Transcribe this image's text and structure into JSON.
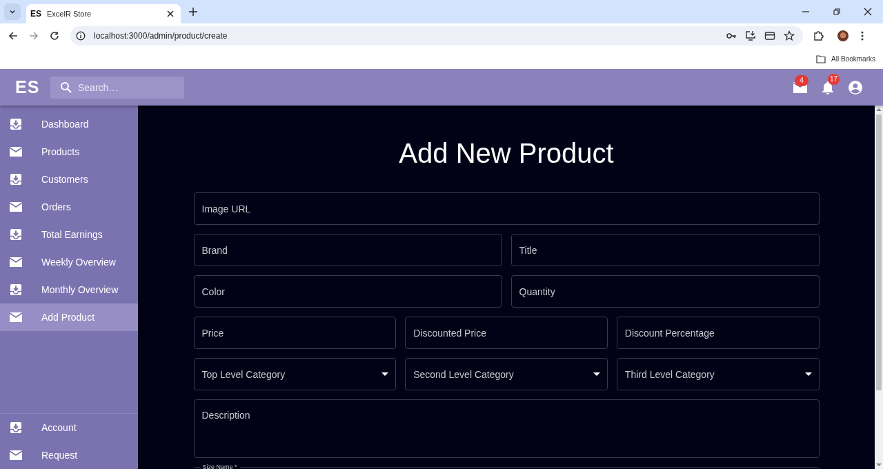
{
  "browser": {
    "tab_favicon": "ES",
    "tab_title": "ExcelR Store",
    "url": "localhost:3000/admin/product/create",
    "bookmarks": "All Bookmarks"
  },
  "header": {
    "logo": "ES",
    "search": {
      "placeholder": "Search…"
    },
    "mail_badge": "4",
    "notification_badge": "17"
  },
  "sidebar": {
    "items": [
      {
        "label": "Dashboard",
        "kind": "inbox",
        "selected": false
      },
      {
        "label": "Products",
        "kind": "mail",
        "selected": false
      },
      {
        "label": "Customers",
        "kind": "inbox",
        "selected": false
      },
      {
        "label": "Orders",
        "kind": "mail",
        "selected": false
      },
      {
        "label": "Total Earnings",
        "kind": "inbox",
        "selected": false
      },
      {
        "label": "Weekly Overview",
        "kind": "mail",
        "selected": false
      },
      {
        "label": "Monthly Overview",
        "kind": "inbox",
        "selected": false
      },
      {
        "label": "Add Product",
        "kind": "mail",
        "selected": true
      }
    ],
    "bottom_items": [
      {
        "label": "Account",
        "kind": "inbox",
        "selected": false
      },
      {
        "label": "Request",
        "kind": "mail",
        "selected": false
      }
    ]
  },
  "form": {
    "title": "Add New Product",
    "rows": [
      [
        {
          "placeholder": "Image URL",
          "kind": "text"
        }
      ],
      [
        {
          "placeholder": "Brand",
          "kind": "text"
        },
        {
          "placeholder": "Title",
          "kind": "text"
        }
      ],
      [
        {
          "placeholder": "Color",
          "kind": "text"
        },
        {
          "placeholder": "Quantity",
          "kind": "text"
        }
      ],
      [
        {
          "placeholder": "Price",
          "kind": "text"
        },
        {
          "placeholder": "Discounted Price",
          "kind": "text"
        },
        {
          "placeholder": "Discount Percentage",
          "kind": "text"
        }
      ],
      [
        {
          "label": "Top Level Category",
          "kind": "select"
        },
        {
          "label": "Second Level Category",
          "kind": "select"
        },
        {
          "label": "Third Level Category",
          "kind": "select"
        }
      ],
      [
        {
          "placeholder": "Description",
          "kind": "textarea"
        }
      ],
      [
        {
          "label": "Size Name *",
          "kind": "floated"
        }
      ]
    ]
  }
}
